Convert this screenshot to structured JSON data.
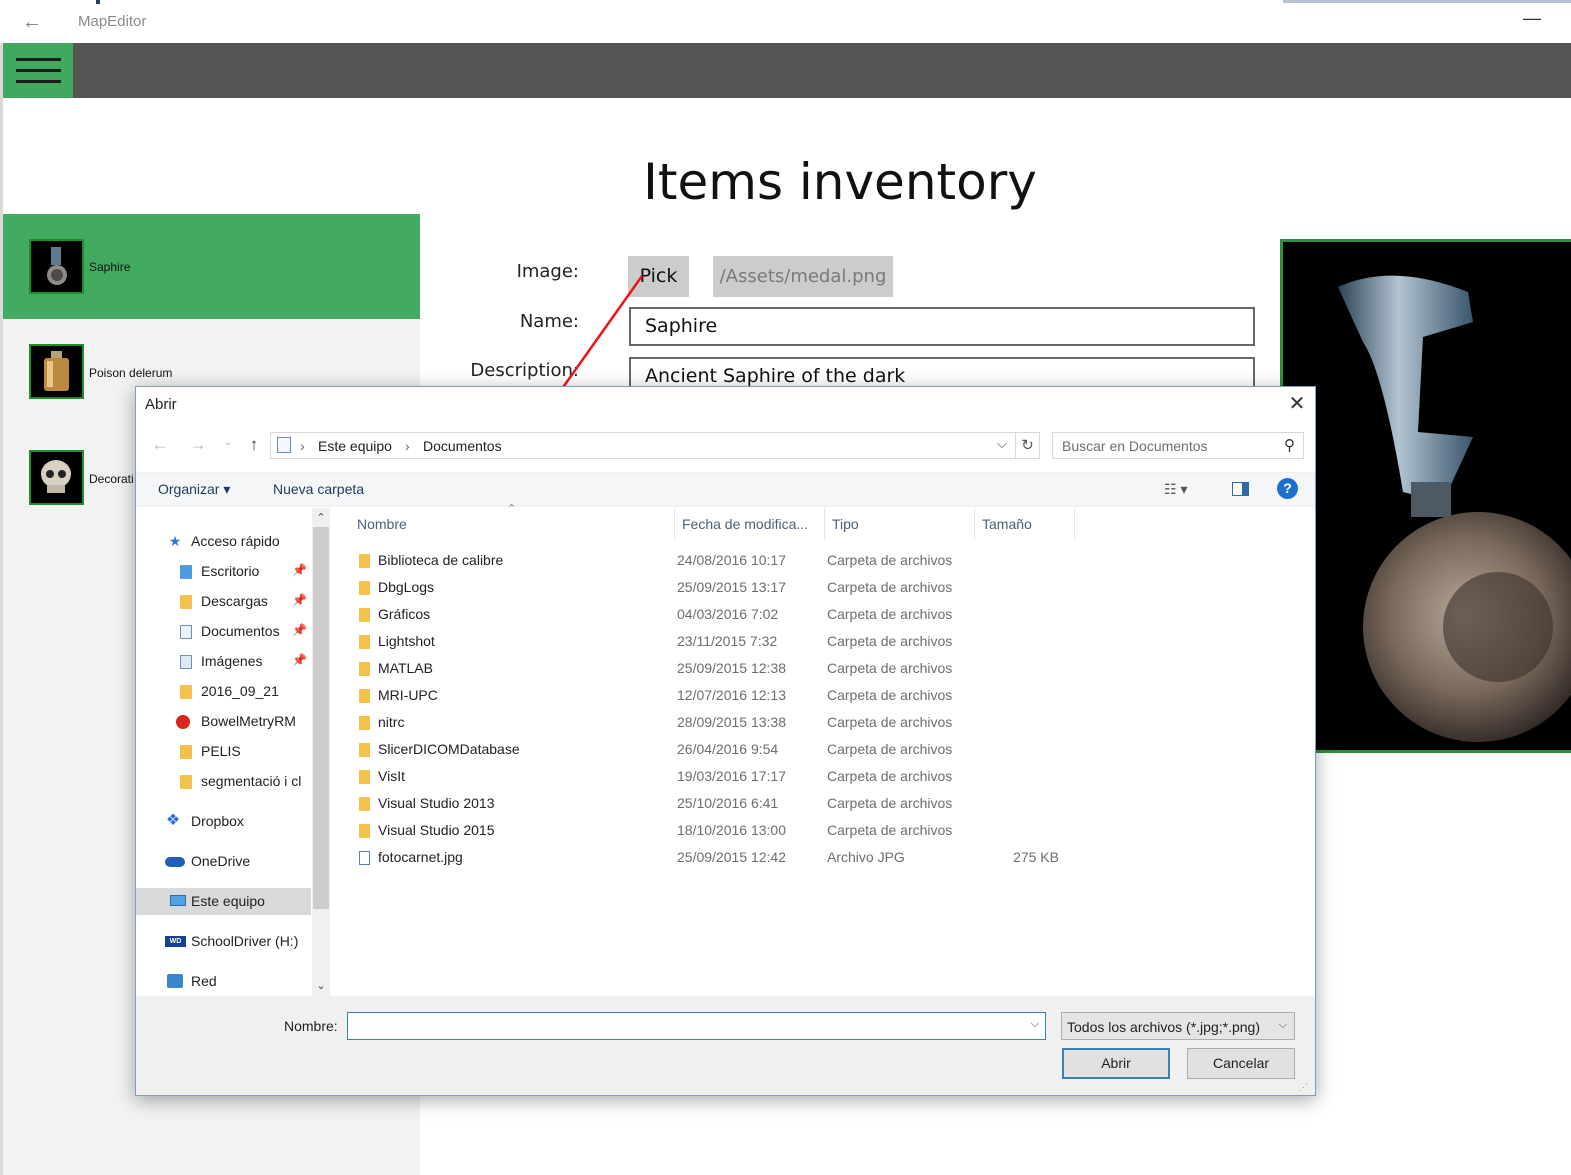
{
  "app": {
    "title": "MapEditor",
    "back_icon": "←",
    "minimize_icon": "—"
  },
  "sidebar": {
    "items": [
      {
        "label": "Saphire",
        "icon": "medal-icon",
        "selected": true
      },
      {
        "label": "Poison delerum",
        "icon": "flask-icon",
        "selected": false
      },
      {
        "label": "Decorati",
        "icon": "skull-icon",
        "selected": false
      }
    ]
  },
  "page": {
    "title": "Items inventory",
    "image_label": "Image:",
    "name_label": "Name:",
    "description_label": "Description:",
    "pick_button": "Pick",
    "image_path": "/Assets/medal.png",
    "name_value": "Saphire",
    "description_value": "Ancient Saphire of the dark"
  },
  "dialog": {
    "title": "Abrir",
    "close_icon": "✕",
    "breadcrumb": [
      "Este equipo",
      "Documentos"
    ],
    "search_placeholder": "Buscar en Documentos",
    "commands": {
      "organize": "Organizar ▾",
      "new_folder": "Nueva carpeta"
    },
    "columns": [
      "Nombre",
      "Fecha de modifica...",
      "Tipo",
      "Tamaño"
    ],
    "nav": [
      {
        "label": "Acceso rápido",
        "icon": "star-icon",
        "level": 0,
        "pinned": false
      },
      {
        "label": "Escritorio",
        "icon": "folder-icon",
        "level": 1,
        "pinned": true
      },
      {
        "label": "Descargas",
        "icon": "folder-icon",
        "level": 1,
        "pinned": true
      },
      {
        "label": "Documentos",
        "icon": "folder-icon",
        "level": 1,
        "pinned": true
      },
      {
        "label": "Imágenes",
        "icon": "folder-icon",
        "level": 1,
        "pinned": true
      },
      {
        "label": "2016_09_21",
        "icon": "folder-icon",
        "level": 1,
        "pinned": false
      },
      {
        "label": "BowelMetryRM",
        "icon": "app-icon",
        "level": 1,
        "pinned": false
      },
      {
        "label": "PELIS",
        "icon": "folder-icon",
        "level": 1,
        "pinned": false
      },
      {
        "label": "segmentació i cl",
        "icon": "folder-icon",
        "level": 1,
        "pinned": false
      },
      {
        "label": "Dropbox",
        "icon": "dropbox-icon",
        "level": 0,
        "pinned": false
      },
      {
        "label": "OneDrive",
        "icon": "cloud-icon",
        "level": 0,
        "pinned": false
      },
      {
        "label": "Este equipo",
        "icon": "computer-icon",
        "level": 0,
        "pinned": false
      },
      {
        "label": "SchoolDriver (H:)",
        "icon": "drive-icon",
        "level": 0,
        "pinned": false
      },
      {
        "label": "Red",
        "icon": "network-icon",
        "level": 0,
        "pinned": false
      }
    ],
    "files": [
      {
        "name": "Biblioteca de calibre",
        "date": "24/08/2016 10:17",
        "type": "Carpeta de archivos",
        "size": ""
      },
      {
        "name": "DbgLogs",
        "date": "25/09/2015 13:17",
        "type": "Carpeta de archivos",
        "size": ""
      },
      {
        "name": "Gráficos",
        "date": "04/03/2016 7:02",
        "type": "Carpeta de archivos",
        "size": ""
      },
      {
        "name": "Lightshot",
        "date": "23/11/2015 7:32",
        "type": "Carpeta de archivos",
        "size": ""
      },
      {
        "name": "MATLAB",
        "date": "25/09/2015 12:38",
        "type": "Carpeta de archivos",
        "size": ""
      },
      {
        "name": "MRI-UPC",
        "date": "12/07/2016 12:13",
        "type": "Carpeta de archivos",
        "size": ""
      },
      {
        "name": "nitrc",
        "date": "28/09/2015 13:38",
        "type": "Carpeta de archivos",
        "size": ""
      },
      {
        "name": "SlicerDICOMDatabase",
        "date": "26/04/2016 9:54",
        "type": "Carpeta de archivos",
        "size": ""
      },
      {
        "name": "VisIt",
        "date": "19/03/2016 17:17",
        "type": "Carpeta de archivos",
        "size": ""
      },
      {
        "name": "Visual Studio 2013",
        "date": "25/10/2016 6:41",
        "type": "Carpeta de archivos",
        "size": ""
      },
      {
        "name": "Visual Studio 2015",
        "date": "18/10/2016 13:00",
        "type": "Carpeta de archivos",
        "size": ""
      },
      {
        "name": "fotocarnet.jpg",
        "date": "25/09/2015 12:42",
        "type": "Archivo JPG",
        "size": "275 KB"
      }
    ],
    "filename_label": "Nombre:",
    "filename_value": "",
    "filter": "Todos los archivos (*.jpg;*.png)",
    "open_button": "Abrir",
    "cancel_button": "Cancelar"
  },
  "colors": {
    "accent_green": "#43aa62",
    "toolbar_gray": "#555555",
    "annotation_red": "#e8141b",
    "dialog_link": "#1e395b"
  }
}
